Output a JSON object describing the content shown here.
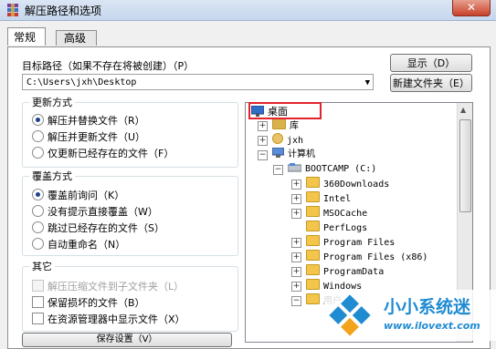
{
  "window": {
    "title": "解压路径和选项",
    "close_label": "✕"
  },
  "tabs": [
    {
      "label": "常规"
    },
    {
      "label": "高级"
    }
  ],
  "target_path": {
    "label": "目标路径（如果不存在将被创建）（P）",
    "value": "C:\\Users\\jxh\\Desktop",
    "show_button": "显示（D）",
    "new_folder_button": "新建文件夹（E）"
  },
  "update_mode": {
    "title": "更新方式",
    "options": [
      {
        "label": "解压并替换文件（R）",
        "selected": true
      },
      {
        "label": "解压并更新文件（U）",
        "selected": false
      },
      {
        "label": "仅更新已经存在的文件（F）",
        "selected": false
      }
    ]
  },
  "overwrite_mode": {
    "title": "覆盖方式",
    "options": [
      {
        "label": "覆盖前询问（K）",
        "selected": true
      },
      {
        "label": "没有提示直接覆盖（W）",
        "selected": false
      },
      {
        "label": "跳过已经存在的文件（S）",
        "selected": false
      },
      {
        "label": "自动重命名（N）",
        "selected": false
      }
    ]
  },
  "misc": {
    "title": "其它",
    "options": [
      {
        "label": "解压压缩文件到子文件夹（L）",
        "checked": false,
        "disabled": true
      },
      {
        "label": "保留损坏的文件（B）",
        "checked": false,
        "disabled": false
      },
      {
        "label": "在资源管理器中显示文件（X）",
        "checked": false,
        "disabled": false
      }
    ]
  },
  "bottom_button": "保存设置（V）",
  "tree": {
    "items": [
      {
        "label": "桌面",
        "icon": "desktop-icon",
        "selected": true
      },
      {
        "label": "库",
        "icon": "library-icon"
      },
      {
        "label": "jxh",
        "icon": "user-icon"
      },
      {
        "label": "计算机",
        "icon": "computer-icon"
      },
      {
        "label": "BOOTCAMP (C:)",
        "icon": "drive-icon"
      },
      {
        "label": "360Downloads",
        "icon": "folder-icon"
      },
      {
        "label": "Intel",
        "icon": "folder-icon"
      },
      {
        "label": "MSOCache",
        "icon": "folder-icon"
      },
      {
        "label": "PerfLogs",
        "icon": "folder-icon"
      },
      {
        "label": "Program Files",
        "icon": "folder-icon"
      },
      {
        "label": "Program Files (x86)",
        "icon": "folder-icon"
      },
      {
        "label": "ProgramData",
        "icon": "folder-icon"
      },
      {
        "label": "Windows",
        "icon": "folder-icon"
      },
      {
        "label": "用户",
        "icon": "folder-icon"
      }
    ]
  },
  "watermark": {
    "name": "小小系统迷",
    "url": "www.ilovext.com",
    "color": "#1f8bd1"
  },
  "colors": {
    "highlight": "#e3222b",
    "tree_folder": "#f3c54b"
  }
}
